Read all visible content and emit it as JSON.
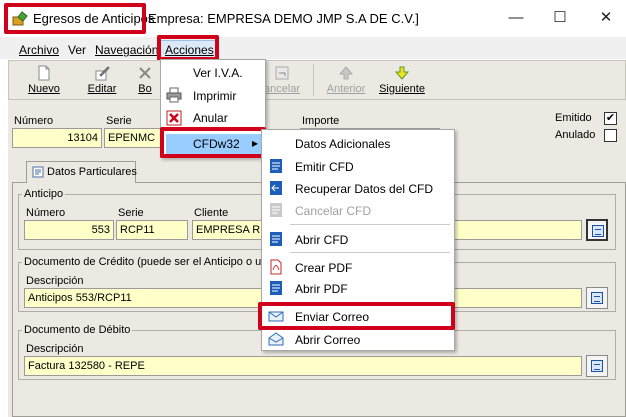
{
  "window": {
    "title": "Egresos de Anticipos",
    "company": "Empresa: EMPRESA DEMO JMP S.A DE C.V.]",
    "minimize_glyph": "—",
    "maximize_glyph": "☐",
    "close_glyph": "✕"
  },
  "menubar": {
    "archivo": "Archivo",
    "ver": "Ver",
    "navegacion": "Navegación",
    "acciones": "Acciones"
  },
  "toolbar": {
    "nuevo": "Nuevo",
    "editar": "Editar",
    "borrar": "Bo",
    "cancelar": "ancelar",
    "anterior": "Anterior",
    "siguiente": "Siguiente"
  },
  "form": {
    "numero_label": "Número",
    "numero_value": "13104",
    "serie_label": "Serie",
    "serie_value": "EPENMC",
    "importe_label": "Importe",
    "emitido_label": "Emitido",
    "emitido_checked": "✔",
    "anulado_label": "Anulado",
    "tab_label": "Datos Particulares",
    "anticipo": {
      "title": "Anticipo",
      "numero_label": "Número",
      "numero_value": "553",
      "serie_label": "Serie",
      "serie_value": "RCP11",
      "cliente_label": "Cliente",
      "cliente_value": "EMPRESA RE"
    },
    "credito": {
      "title": "Documento de Crédito (puede ser el Anticipo o un",
      "desc_label": "Descripción",
      "desc_value": "Anticipos 553/RCP11"
    },
    "debito": {
      "title": "Documento de Débito",
      "desc_label": "Descripción",
      "desc_value": "Factura 132580 - REPE"
    }
  },
  "acciones_menu": {
    "ver_iva": "Ver I.V.A.",
    "imprimir": "Imprimir",
    "anular": "Anular",
    "cfdw32": "CFDw32",
    "submenu_arrow": "▸"
  },
  "cfd_submenu": {
    "datos_adicionales": "Datos Adicionales",
    "emitir_cfd": "Emitir CFD",
    "recuperar_datos": "Recuperar Datos del CFD",
    "cancelar_cfd": "Cancelar CFD",
    "abrir_cfd": "Abrir CFD",
    "crear_pdf": "Crear PDF",
    "abrir_pdf": "Abrir PDF",
    "enviar_correo": "Enviar Correo",
    "abrir_correo": "Abrir Correo"
  },
  "colors": {
    "highlight": "#d0021b",
    "menu_selected": "#99ccff",
    "field_yellow": "#ffffc8",
    "form_bg": "#ece9e2"
  }
}
